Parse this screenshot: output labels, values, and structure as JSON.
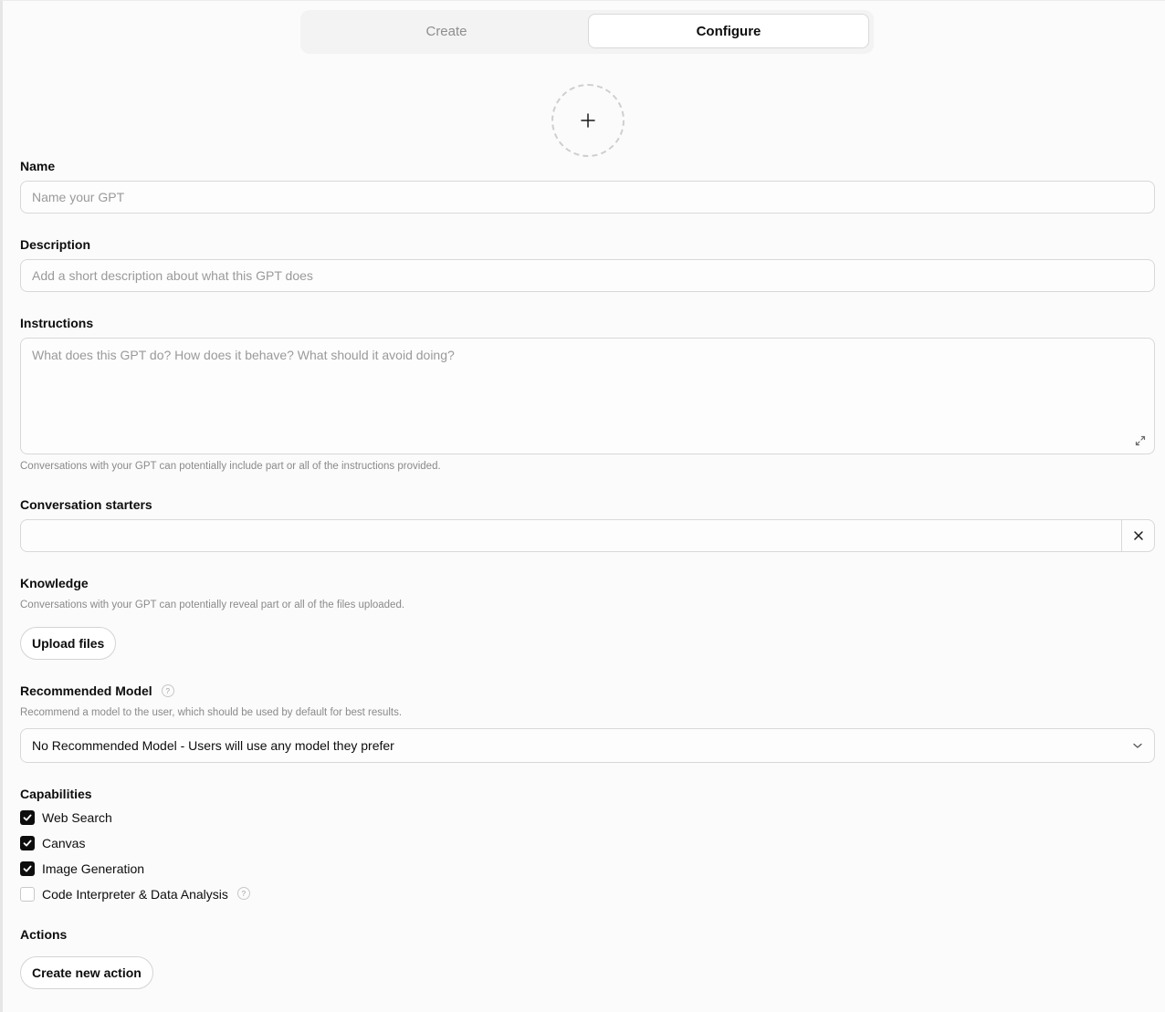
{
  "tabs": {
    "create": "Create",
    "configure": "Configure"
  },
  "avatar": {
    "icon": "plus-icon"
  },
  "name": {
    "label": "Name",
    "placeholder": "Name your GPT",
    "value": ""
  },
  "description": {
    "label": "Description",
    "placeholder": "Add a short description about what this GPT does",
    "value": ""
  },
  "instructions": {
    "label": "Instructions",
    "placeholder": "What does this GPT do? How does it behave? What should it avoid doing?",
    "value": "",
    "hint": "Conversations with your GPT can potentially include part or all of the instructions provided.",
    "expand_icon": "expand-icon"
  },
  "starters": {
    "label": "Conversation starters",
    "value": "",
    "clear_icon": "close-icon"
  },
  "knowledge": {
    "label": "Knowledge",
    "hint": "Conversations with your GPT can potentially reveal part or all of the files uploaded.",
    "upload_label": "Upload files"
  },
  "model": {
    "label": "Recommended Model",
    "help": "?",
    "hint": "Recommend a model to the user, which should be used by default for best results.",
    "selected": "No Recommended Model - Users will use any model they prefer"
  },
  "capabilities": {
    "label": "Capabilities",
    "items": [
      {
        "label": "Web Search",
        "checked": true
      },
      {
        "label": "Canvas",
        "checked": true
      },
      {
        "label": "Image Generation",
        "checked": true
      },
      {
        "label": "Code Interpreter & Data Analysis",
        "checked": false,
        "help": "?"
      }
    ]
  },
  "actions": {
    "label": "Actions",
    "create_label": "Create new action"
  },
  "colors": {
    "text": "#0d0d0d",
    "muted": "#8a8a8a",
    "border": "#d8d8d8",
    "checked": "#0d0d0d"
  }
}
